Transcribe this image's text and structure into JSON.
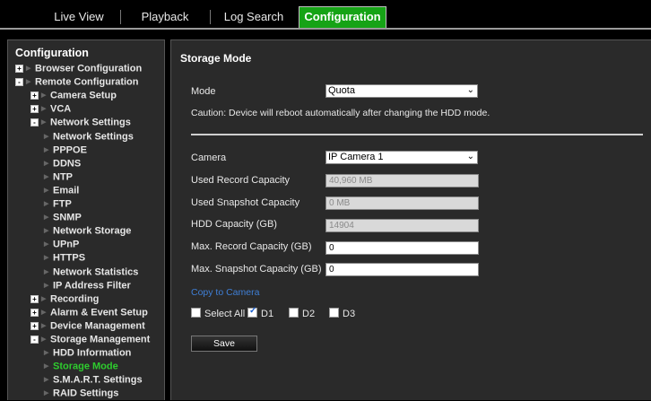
{
  "tabs": [
    {
      "label": "Live View",
      "active": false
    },
    {
      "label": "Playback",
      "active": false
    },
    {
      "label": "Log Search",
      "active": false
    },
    {
      "label": "Configuration",
      "active": true
    }
  ],
  "sidebar": {
    "title": "Configuration",
    "items": [
      {
        "label": "Browser Configuration",
        "level": 0,
        "expander": "+"
      },
      {
        "label": "Remote Configuration",
        "level": 0,
        "expander": "-"
      },
      {
        "label": "Camera Setup",
        "level": 1,
        "expander": "+"
      },
      {
        "label": "VCA",
        "level": 1,
        "expander": "+"
      },
      {
        "label": "Network Settings",
        "level": 1,
        "expander": "-"
      },
      {
        "label": "Network Settings",
        "level": 2
      },
      {
        "label": "PPPOE",
        "level": 2
      },
      {
        "label": "DDNS",
        "level": 2
      },
      {
        "label": "NTP",
        "level": 2
      },
      {
        "label": "Email",
        "level": 2
      },
      {
        "label": "FTP",
        "level": 2
      },
      {
        "label": "SNMP",
        "level": 2
      },
      {
        "label": "Network Storage",
        "level": 2
      },
      {
        "label": "UPnP",
        "level": 2
      },
      {
        "label": "HTTPS",
        "level": 2
      },
      {
        "label": "Network Statistics",
        "level": 2
      },
      {
        "label": "IP Address Filter",
        "level": 2
      },
      {
        "label": "Recording",
        "level": 1,
        "expander": "+"
      },
      {
        "label": "Alarm & Event Setup",
        "level": 1,
        "expander": "+"
      },
      {
        "label": "Device Management",
        "level": 1,
        "expander": "+"
      },
      {
        "label": "Storage Management",
        "level": 1,
        "expander": "-"
      },
      {
        "label": "HDD Information",
        "level": 2
      },
      {
        "label": "Storage Mode",
        "level": 2,
        "selected": true
      },
      {
        "label": "S.M.A.R.T. Settings",
        "level": 2
      },
      {
        "label": "RAID Settings",
        "level": 2
      }
    ]
  },
  "main": {
    "title": "Storage Mode",
    "mode_label": "Mode",
    "mode_value": "Quota",
    "caution": "Caution: Device will reboot automatically after changing the HDD mode.",
    "camera_label": "Camera",
    "camera_value": "IP Camera 1",
    "used_record_label": "Used Record Capacity",
    "used_record_value": "40,960 MB",
    "used_snapshot_label": "Used Snapshot Capacity",
    "used_snapshot_value": "0 MB",
    "hdd_capacity_label": "HDD Capacity (GB)",
    "hdd_capacity_value": "14904",
    "max_record_label": "Max. Record Capacity (GB)",
    "max_record_value": "0",
    "max_snapshot_label": "Max. Snapshot Capacity (GB)",
    "max_snapshot_value": "0",
    "copy_link": "Copy to Camera",
    "select_all_label": "Select All",
    "d1_label": "D1",
    "d2_label": "D2",
    "d3_label": "D3",
    "save_label": "Save"
  },
  "colors": {
    "active_tab": "#16a316",
    "selected_item": "#2ecc2e",
    "link": "#3f7fd6"
  }
}
